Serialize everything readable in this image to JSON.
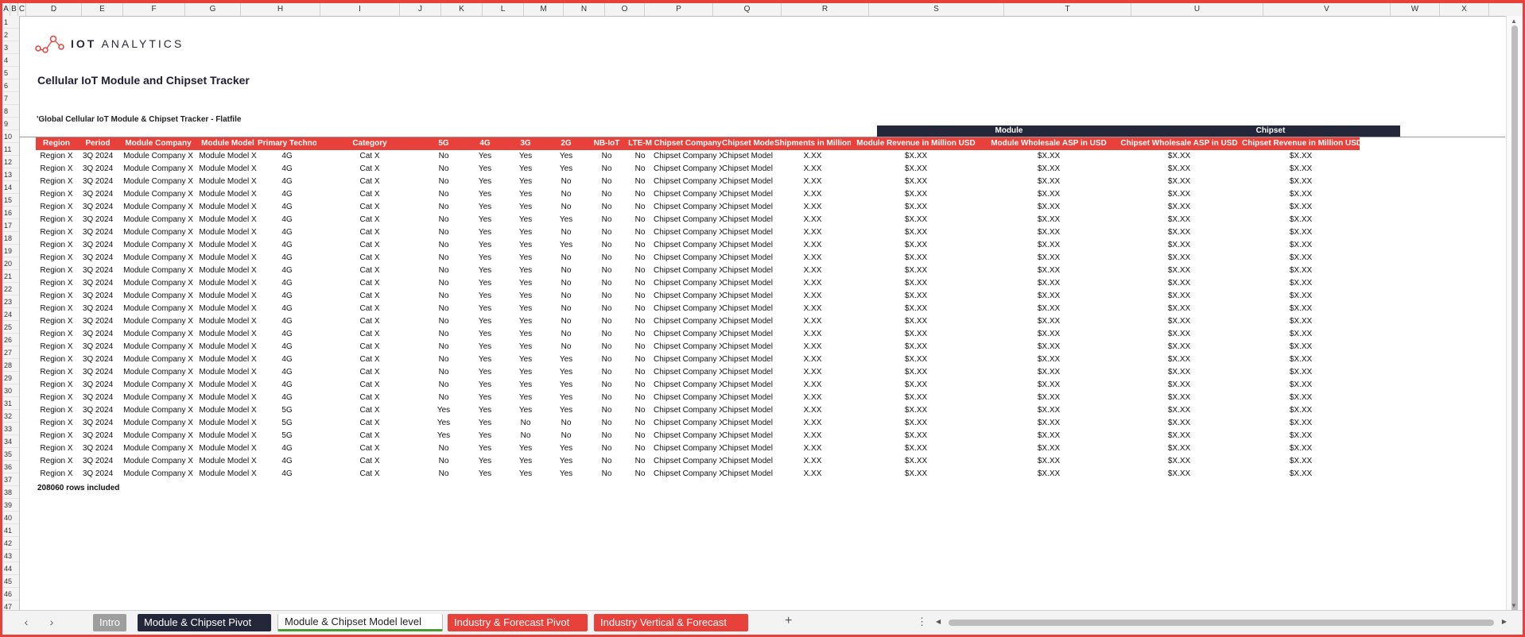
{
  "columns": [
    "A",
    "B",
    "C",
    "D",
    "E",
    "F",
    "G",
    "H",
    "I",
    "J",
    "K",
    "L",
    "M",
    "N",
    "O",
    "P",
    "Q",
    "R",
    "S",
    "T",
    "U",
    "V",
    "W",
    "X"
  ],
  "rows": [
    "1",
    "2",
    "3",
    "4",
    "5",
    "6",
    "7",
    "8",
    "9",
    "10",
    "11",
    "12",
    "13",
    "14",
    "15",
    "16",
    "17",
    "18",
    "19",
    "20",
    "21",
    "22",
    "23",
    "24",
    "25",
    "26",
    "27",
    "28",
    "29",
    "30",
    "31",
    "32",
    "33",
    "34",
    "35",
    "36",
    "37",
    "38",
    "39",
    "40",
    "41",
    "42",
    "43",
    "44",
    "45",
    "46",
    "47"
  ],
  "logo": {
    "brand_bold": "IOT",
    "brand_rest": "ANALYTICS"
  },
  "title": "Cellular IoT Module and Chipset Tracker",
  "subtitle": "'Global Cellular IoT Module & Chipset Tracker - Flatfile",
  "groups": {
    "module": "Module",
    "chipset": "Chipset"
  },
  "headers": [
    "Region",
    "Period",
    "Module Company",
    "Module Model",
    "Primary Technology",
    "Category",
    "5G",
    "4G",
    "3G",
    "2G",
    "NB-IoT",
    "LTE-M",
    "Chipset Company",
    "Chipset Model",
    "Shipments in Million",
    "Module Revenue in Million USD",
    "Module Wholesale ASP in USD",
    "Chipset Wholesale ASP in USD",
    "Chipset Revenue in Million USD"
  ],
  "table_rows": [
    [
      "Region X",
      "3Q 2024",
      "Module Company X",
      "Module Model X",
      "4G",
      "Cat X",
      "No",
      "Yes",
      "Yes",
      "Yes",
      "No",
      "No",
      "Chipset Company X",
      "Chipset Model X",
      "X.XX",
      "$X.XX",
      "$X.XX",
      "$X.XX",
      "$X.XX"
    ],
    [
      "Region X",
      "3Q 2024",
      "Module Company X",
      "Module Model X",
      "4G",
      "Cat X",
      "No",
      "Yes",
      "Yes",
      "Yes",
      "No",
      "No",
      "Chipset Company X",
      "Chipset Model X",
      "X.XX",
      "$X.XX",
      "$X.XX",
      "$X.XX",
      "$X.XX"
    ],
    [
      "Region X",
      "3Q 2024",
      "Module Company X",
      "Module Model X",
      "4G",
      "Cat X",
      "No",
      "Yes",
      "Yes",
      "No",
      "No",
      "No",
      "Chipset Company X",
      "Chipset Model X",
      "X.XX",
      "$X.XX",
      "$X.XX",
      "$X.XX",
      "$X.XX"
    ],
    [
      "Region X",
      "3Q 2024",
      "Module Company X",
      "Module Model X",
      "4G",
      "Cat X",
      "No",
      "Yes",
      "Yes",
      "No",
      "No",
      "No",
      "Chipset Company X",
      "Chipset Model X",
      "X.XX",
      "$X.XX",
      "$X.XX",
      "$X.XX",
      "$X.XX"
    ],
    [
      "Region X",
      "3Q 2024",
      "Module Company X",
      "Module Model X",
      "4G",
      "Cat X",
      "No",
      "Yes",
      "Yes",
      "No",
      "No",
      "No",
      "Chipset Company X",
      "Chipset Model X",
      "X.XX",
      "$X.XX",
      "$X.XX",
      "$X.XX",
      "$X.XX"
    ],
    [
      "Region X",
      "3Q 2024",
      "Module Company X",
      "Module Model X",
      "4G",
      "Cat X",
      "No",
      "Yes",
      "Yes",
      "Yes",
      "No",
      "No",
      "Chipset Company X",
      "Chipset Model X",
      "X.XX",
      "$X.XX",
      "$X.XX",
      "$X.XX",
      "$X.XX"
    ],
    [
      "Region X",
      "3Q 2024",
      "Module Company X",
      "Module Model X",
      "4G",
      "Cat X",
      "No",
      "Yes",
      "Yes",
      "No",
      "No",
      "No",
      "Chipset Company X",
      "Chipset Model X",
      "X.XX",
      "$X.XX",
      "$X.XX",
      "$X.XX",
      "$X.XX"
    ],
    [
      "Region X",
      "3Q 2024",
      "Module Company X",
      "Module Model X",
      "4G",
      "Cat X",
      "No",
      "Yes",
      "Yes",
      "Yes",
      "No",
      "No",
      "Chipset Company X",
      "Chipset Model X",
      "X.XX",
      "$X.XX",
      "$X.XX",
      "$X.XX",
      "$X.XX"
    ],
    [
      "Region X",
      "3Q 2024",
      "Module Company X",
      "Module Model X",
      "4G",
      "Cat X",
      "No",
      "Yes",
      "Yes",
      "No",
      "No",
      "No",
      "Chipset Company X",
      "Chipset Model X",
      "X.XX",
      "$X.XX",
      "$X.XX",
      "$X.XX",
      "$X.XX"
    ],
    [
      "Region X",
      "3Q 2024",
      "Module Company X",
      "Module Model X",
      "4G",
      "Cat X",
      "No",
      "Yes",
      "Yes",
      "No",
      "No",
      "No",
      "Chipset Company X",
      "Chipset Model X",
      "X.XX",
      "$X.XX",
      "$X.XX",
      "$X.XX",
      "$X.XX"
    ],
    [
      "Region X",
      "3Q 2024",
      "Module Company X",
      "Module Model X",
      "4G",
      "Cat X",
      "No",
      "Yes",
      "Yes",
      "No",
      "No",
      "No",
      "Chipset Company X",
      "Chipset Model X",
      "X.XX",
      "$X.XX",
      "$X.XX",
      "$X.XX",
      "$X.XX"
    ],
    [
      "Region X",
      "3Q 2024",
      "Module Company X",
      "Module Model X",
      "4G",
      "Cat X",
      "No",
      "Yes",
      "Yes",
      "No",
      "No",
      "No",
      "Chipset Company X",
      "Chipset Model X",
      "X.XX",
      "$X.XX",
      "$X.XX",
      "$X.XX",
      "$X.XX"
    ],
    [
      "Region X",
      "3Q 2024",
      "Module Company X",
      "Module Model X",
      "4G",
      "Cat X",
      "No",
      "Yes",
      "Yes",
      "No",
      "No",
      "No",
      "Chipset Company X",
      "Chipset Model X",
      "X.XX",
      "$X.XX",
      "$X.XX",
      "$X.XX",
      "$X.XX"
    ],
    [
      "Region X",
      "3Q 2024",
      "Module Company X",
      "Module Model X",
      "4G",
      "Cat X",
      "No",
      "Yes",
      "Yes",
      "No",
      "No",
      "No",
      "Chipset Company X",
      "Chipset Model X",
      "X.XX",
      "$X.XX",
      "$X.XX",
      "$X.XX",
      "$X.XX"
    ],
    [
      "Region X",
      "3Q 2024",
      "Module Company X",
      "Module Model X",
      "4G",
      "Cat X",
      "No",
      "Yes",
      "Yes",
      "No",
      "No",
      "No",
      "Chipset Company X",
      "Chipset Model X",
      "X.XX",
      "$X.XX",
      "$X.XX",
      "$X.XX",
      "$X.XX"
    ],
    [
      "Region X",
      "3Q 2024",
      "Module Company X",
      "Module Model X",
      "4G",
      "Cat X",
      "No",
      "Yes",
      "Yes",
      "No",
      "No",
      "No",
      "Chipset Company X",
      "Chipset Model X",
      "X.XX",
      "$X.XX",
      "$X.XX",
      "$X.XX",
      "$X.XX"
    ],
    [
      "Region X",
      "3Q 2024",
      "Module Company X",
      "Module Model X",
      "4G",
      "Cat X",
      "No",
      "Yes",
      "Yes",
      "Yes",
      "No",
      "No",
      "Chipset Company X",
      "Chipset Model X",
      "X.XX",
      "$X.XX",
      "$X.XX",
      "$X.XX",
      "$X.XX"
    ],
    [
      "Region X",
      "3Q 2024",
      "Module Company X",
      "Module Model X",
      "4G",
      "Cat X",
      "No",
      "Yes",
      "Yes",
      "Yes",
      "No",
      "No",
      "Chipset Company X",
      "Chipset Model X",
      "X.XX",
      "$X.XX",
      "$X.XX",
      "$X.XX",
      "$X.XX"
    ],
    [
      "Region X",
      "3Q 2024",
      "Module Company X",
      "Module Model X",
      "4G",
      "Cat X",
      "No",
      "Yes",
      "Yes",
      "Yes",
      "No",
      "No",
      "Chipset Company X",
      "Chipset Model X",
      "X.XX",
      "$X.XX",
      "$X.XX",
      "$X.XX",
      "$X.XX"
    ],
    [
      "Region X",
      "3Q 2024",
      "Module Company X",
      "Module Model X",
      "4G",
      "Cat X",
      "No",
      "Yes",
      "Yes",
      "Yes",
      "No",
      "No",
      "Chipset Company X",
      "Chipset Model X",
      "X.XX",
      "$X.XX",
      "$X.XX",
      "$X.XX",
      "$X.XX"
    ],
    [
      "Region X",
      "3Q 2024",
      "Module Company X",
      "Module Model X",
      "5G",
      "Cat X",
      "Yes",
      "Yes",
      "Yes",
      "Yes",
      "No",
      "No",
      "Chipset Company X",
      "Chipset Model X",
      "X.XX",
      "$X.XX",
      "$X.XX",
      "$X.XX",
      "$X.XX"
    ],
    [
      "Region X",
      "3Q 2024",
      "Module Company X",
      "Module Model X",
      "5G",
      "Cat X",
      "Yes",
      "Yes",
      "No",
      "No",
      "No",
      "No",
      "Chipset Company X",
      "Chipset Model X",
      "X.XX",
      "$X.XX",
      "$X.XX",
      "$X.XX",
      "$X.XX"
    ],
    [
      "Region X",
      "3Q 2024",
      "Module Company X",
      "Module Model X",
      "5G",
      "Cat X",
      "Yes",
      "Yes",
      "No",
      "No",
      "No",
      "No",
      "Chipset Company X",
      "Chipset Model X",
      "X.XX",
      "$X.XX",
      "$X.XX",
      "$X.XX",
      "$X.XX"
    ],
    [
      "Region X",
      "3Q 2024",
      "Module Company X",
      "Module Model X",
      "4G",
      "Cat X",
      "No",
      "Yes",
      "Yes",
      "Yes",
      "No",
      "No",
      "Chipset Company X",
      "Chipset Model X",
      "X.XX",
      "$X.XX",
      "$X.XX",
      "$X.XX",
      "$X.XX"
    ],
    [
      "Region X",
      "3Q 2024",
      "Module Company X",
      "Module Model X",
      "4G",
      "Cat X",
      "No",
      "Yes",
      "Yes",
      "Yes",
      "No",
      "No",
      "Chipset Company X",
      "Chipset Model X",
      "X.XX",
      "$X.XX",
      "$X.XX",
      "$X.XX",
      "$X.XX"
    ],
    [
      "Region X",
      "3Q 2024",
      "Module Company X",
      "Module Model X",
      "4G",
      "Cat X",
      "No",
      "Yes",
      "Yes",
      "Yes",
      "No",
      "No",
      "Chipset Company X",
      "Chipset Model X",
      "X.XX",
      "$X.XX",
      "$X.XX",
      "$X.XX",
      "$X.XX"
    ]
  ],
  "footnote": "208060 rows included",
  "tabs": [
    {
      "label": "Intro",
      "color": "#9e9e9e"
    },
    {
      "label": "Module & Chipset Pivot",
      "color": "#24263a"
    },
    {
      "label": "Module & Chipset Model level",
      "color": "#ffffff"
    },
    {
      "label": "Industry & Forecast Pivot",
      "color": "#e8403a"
    },
    {
      "label": "Industry Vertical & Forecast",
      "color": "#e8403a"
    }
  ],
  "nav": {
    "prev": "‹",
    "next": "›",
    "add": "+",
    "more": "⋮"
  },
  "colors": {
    "accent": "#e8403a",
    "navy": "#24263a"
  }
}
